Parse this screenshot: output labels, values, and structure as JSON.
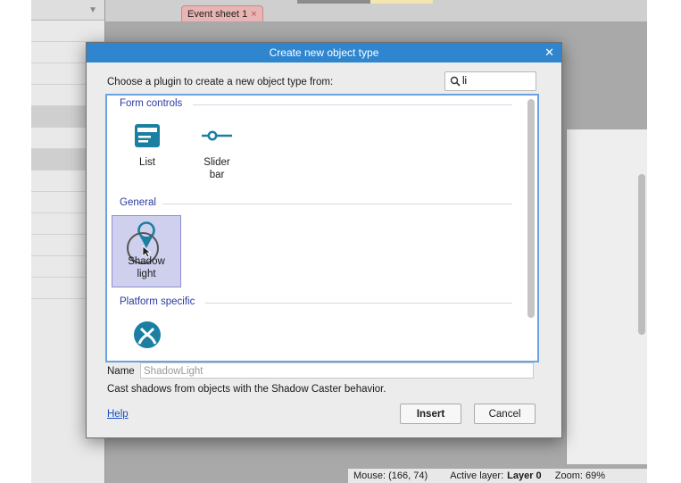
{
  "editor": {
    "tab_label": "Event sheet 1",
    "tab_close_glyph": "×",
    "collapse_glyph": "▼"
  },
  "status_bar": {
    "mouse": "Mouse: (166, 74)",
    "active_layer_label": "Active layer:",
    "active_layer_value": "Layer 0",
    "zoom": "Zoom: 69%"
  },
  "dialog": {
    "title": "Create new object type",
    "close_glyph": "✕",
    "prompt": "Choose a plugin to create a new object type from:",
    "search": {
      "value": "li",
      "placeholder": ""
    },
    "sections": [
      {
        "header": "Form controls",
        "items": [
          {
            "label_line1": "List",
            "label_line2": "",
            "icon": "list-icon"
          },
          {
            "label_line1": "Slider",
            "label_line2": "bar",
            "icon": "slider-bar-icon"
          }
        ]
      },
      {
        "header": "General",
        "items": [
          {
            "label_line1": "Shadow",
            "label_line2": "light",
            "icon": "shadow-light-icon",
            "selected": true
          }
        ]
      },
      {
        "header": "Platform specific",
        "items": [
          {
            "label_line1": "",
            "label_line2": "",
            "icon": "xbox-icon"
          }
        ]
      }
    ],
    "name_label": "Name",
    "name_value": "ShadowLight",
    "description": "Cast shadows from objects with the Shadow Caster behavior.",
    "help_link": "Help",
    "insert_label": "Insert",
    "cancel_label": "Cancel"
  },
  "colors": {
    "titlebar": "#2f86cf",
    "section_header": "#2a3aa0",
    "icon_teal": "#1a7fa0",
    "selected_item": "#cfcfee",
    "tab_pink": "#e8b4b4"
  }
}
